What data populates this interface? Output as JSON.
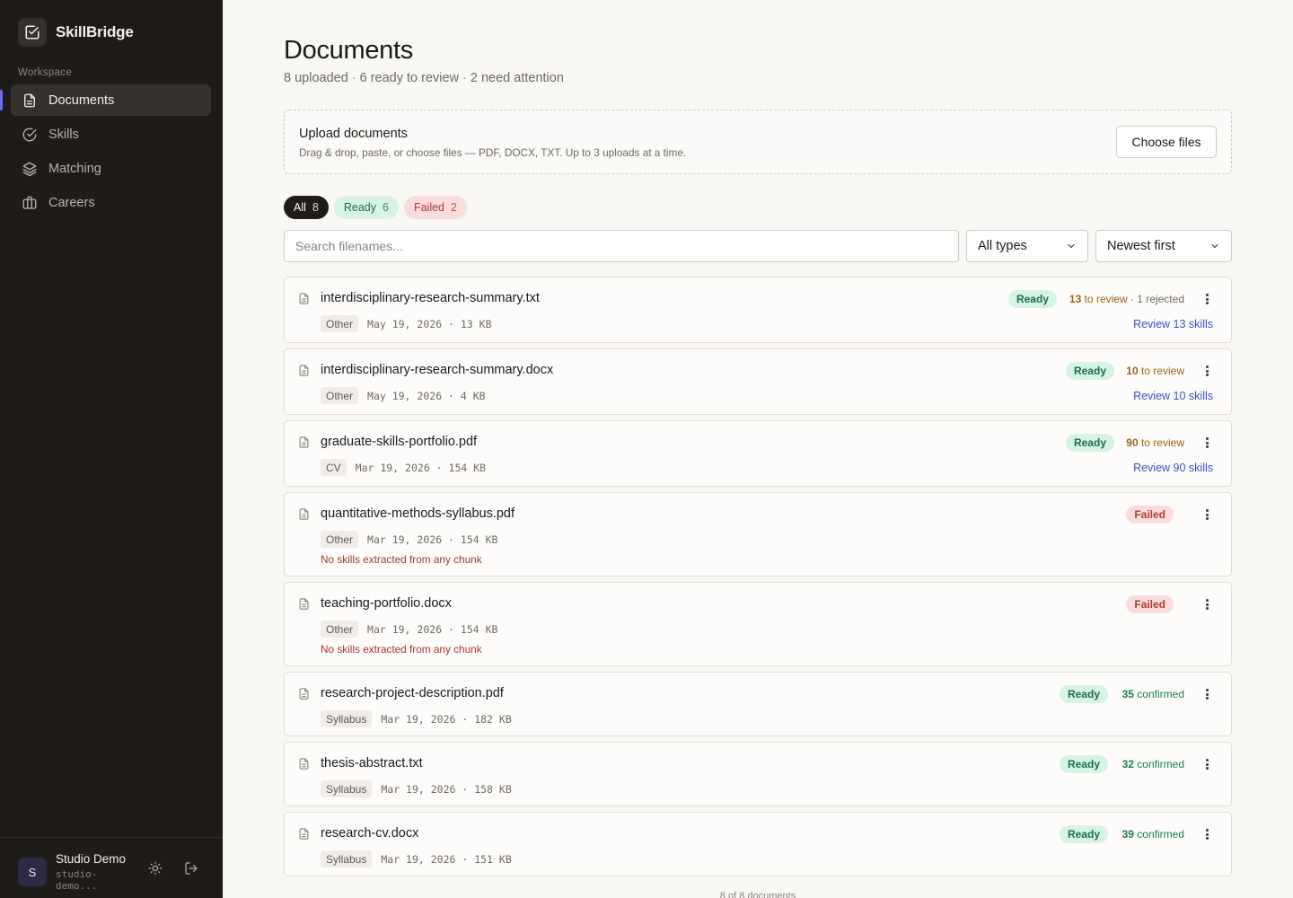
{
  "app": {
    "name": "SkillBridge"
  },
  "sidebar": {
    "section_label": "Workspace",
    "items": [
      {
        "label": "Documents",
        "icon": "document-icon"
      },
      {
        "label": "Skills",
        "icon": "check-circle-icon"
      },
      {
        "label": "Matching",
        "icon": "layers-icon"
      },
      {
        "label": "Careers",
        "icon": "briefcase-icon"
      }
    ],
    "user": {
      "initial": "S",
      "name": "Studio Demo",
      "email": "studio-demo..."
    }
  },
  "page": {
    "title": "Documents",
    "summary": {
      "uploaded": "8 uploaded",
      "ready": "6 ready to review",
      "attention": "2 need attention"
    }
  },
  "upload": {
    "title": "Upload documents",
    "subtitle": "Drag & drop, paste, or choose files — PDF, DOCX, TXT. Up to 3 uploads at a time.",
    "button": "Choose files"
  },
  "filters": {
    "all": {
      "label": "All",
      "count": "8"
    },
    "ready": {
      "label": "Ready",
      "count": "6"
    },
    "failed": {
      "label": "Failed",
      "count": "2"
    }
  },
  "search": {
    "placeholder": "Search filenames..."
  },
  "type_select": {
    "value": "All types"
  },
  "sort_select": {
    "value": "Newest first"
  },
  "documents": [
    {
      "name": "interdisciplinary-research-summary.txt",
      "tag": "Other",
      "meta": "May 19, 2026 · 13 KB",
      "status": "Ready",
      "review_count": "13",
      "review_label": " to review",
      "rejected": " · 1 rejected",
      "link": "Review 13 skills"
    },
    {
      "name": "interdisciplinary-research-summary.docx",
      "tag": "Other",
      "meta": "May 19, 2026 · 4 KB",
      "status": "Ready",
      "review_count": "10",
      "review_label": " to review",
      "link": "Review 10 skills"
    },
    {
      "name": "graduate-skills-portfolio.pdf",
      "tag": "CV",
      "meta": "Mar 19, 2026 · 154 KB",
      "status": "Ready",
      "review_count": "90",
      "review_label": " to review",
      "link": "Review 90 skills"
    },
    {
      "name": "quantitative-methods-syllabus.pdf",
      "tag": "Other",
      "meta": "Mar 19, 2026 · 154 KB",
      "status": "Failed",
      "error": "No skills extracted from any chunk"
    },
    {
      "name": "teaching-portfolio.docx",
      "tag": "Other",
      "meta": "Mar 19, 2026 · 154 KB",
      "status": "Failed",
      "error": "No skills extracted from any chunk"
    },
    {
      "name": "research-project-description.pdf",
      "tag": "Syllabus",
      "meta": "Mar 19, 2026 · 182 KB",
      "status": "Ready",
      "confirmed_count": "35",
      "confirmed_label": " confirmed"
    },
    {
      "name": "thesis-abstract.txt",
      "tag": "Syllabus",
      "meta": "Mar 19, 2026 · 158 KB",
      "status": "Ready",
      "confirmed_count": "32",
      "confirmed_label": " confirmed"
    },
    {
      "name": "research-cv.docx",
      "tag": "Syllabus",
      "meta": "Mar 19, 2026 · 151 KB",
      "status": "Ready",
      "confirmed_count": "39",
      "confirmed_label": " confirmed"
    }
  ],
  "pager": {
    "text": "8 of 8 documents"
  }
}
